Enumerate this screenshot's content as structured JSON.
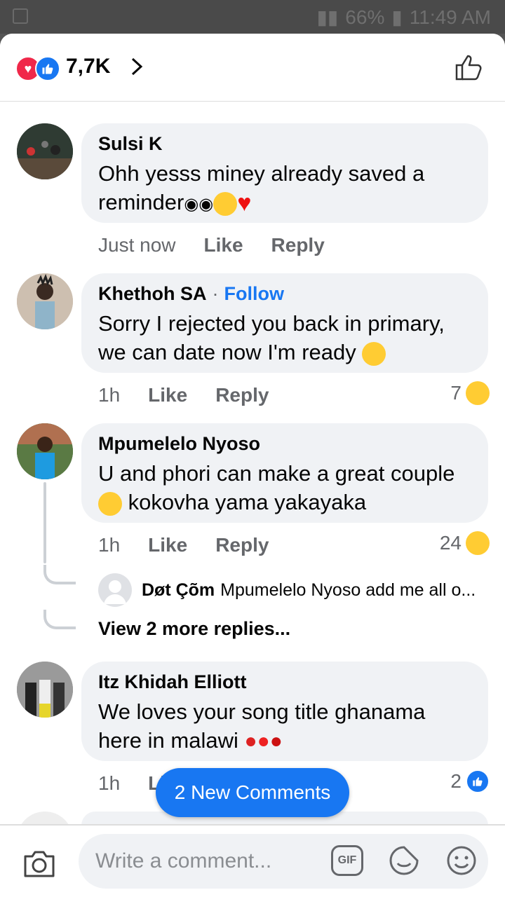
{
  "status_bar": {
    "battery": "66%",
    "time": "11:49 AM"
  },
  "header": {
    "reaction_count": "7,7K"
  },
  "comments": [
    {
      "author": "Sulsi K",
      "text": "Ohh yesss miney already saved a reminder",
      "time": "Just now",
      "like_label": "Like",
      "reply_label": "Reply"
    },
    {
      "author": "Khethoh SA",
      "follow_label": "Follow",
      "text": "Sorry I rejected you back in primary, we can date now I'm ready",
      "time": "1h",
      "like_label": "Like",
      "reply_label": "Reply",
      "reaction_count": "7"
    },
    {
      "author": "Mpumelelo Nyoso",
      "text": "U and phori can make a great couple",
      "text_suffix": "kokovha yama yakayaka",
      "time": "1h",
      "like_label": "Like",
      "reply_label": "Reply",
      "reaction_count": "24"
    },
    {
      "author": "Itz Khidah Elliott",
      "text": "We loves your song title ghanama here in malawi",
      "time": "1h",
      "like_label": "Li",
      "reaction_count": "2"
    }
  ],
  "reply_preview": {
    "author": "Døt Çõm",
    "text": "Mpumelelo Nyoso add me all o..."
  },
  "view_more": "View 2 more replies...",
  "new_comments_button": "2 New Comments",
  "composer": {
    "placeholder": "Write a comment...",
    "gif_label": "GIF"
  },
  "colors": {
    "accent": "#1877f2",
    "bubble": "#f0f2f5",
    "heart": "#f0284a"
  }
}
